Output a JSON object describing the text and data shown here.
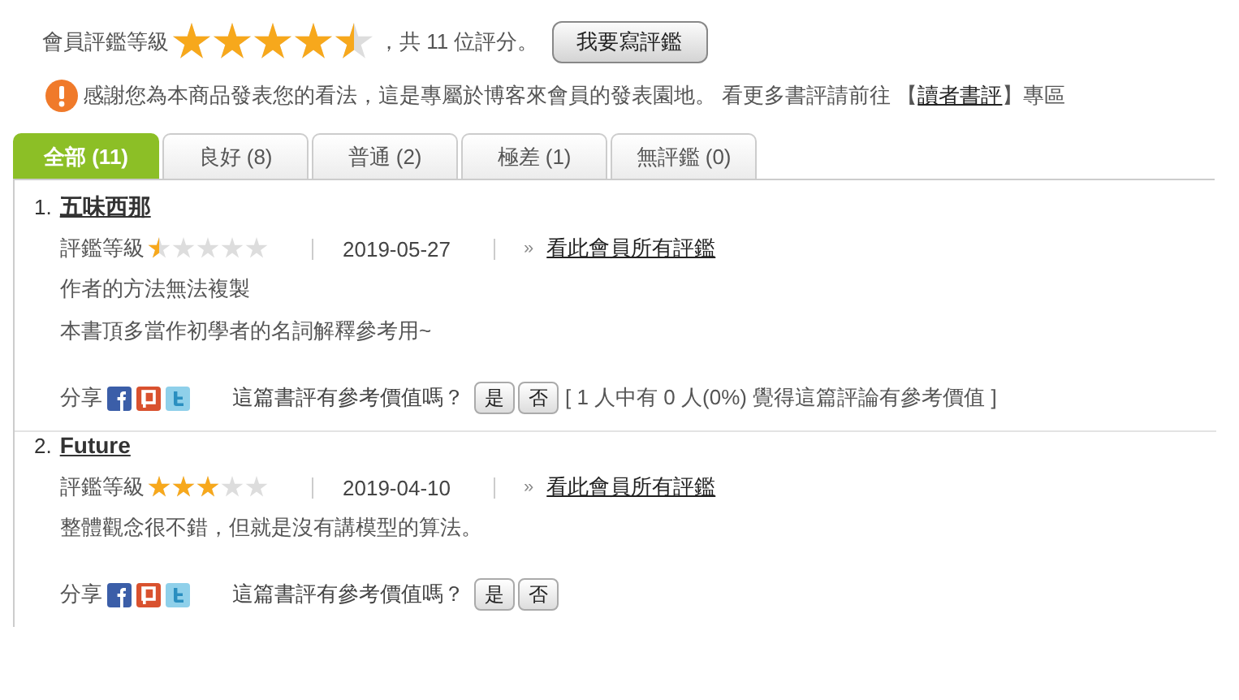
{
  "summary": {
    "label": "會員評鑑等級",
    "stars": 4.5,
    "count_text": "，共 11 位評分。",
    "write_button": "我要寫評鑑"
  },
  "notice": {
    "text": "感謝您為本商品發表您的看法，這是專屬於博客來會員的發表園地。 看更多書評請前往 【",
    "link": "讀者書評",
    "suffix": "】專區"
  },
  "tabs": [
    {
      "label": "全部 (11)",
      "selected": true
    },
    {
      "label": "良好 (8)",
      "selected": false
    },
    {
      "label": "普通 (2)",
      "selected": false
    },
    {
      "label": "極差 (1)",
      "selected": false
    },
    {
      "label": "無評鑑 (0)",
      "selected": false
    }
  ],
  "reviews": [
    {
      "number": "1.",
      "reviewer": "五味西那",
      "rating_label": "評鑑等級",
      "stars": 0.5,
      "date": "2019-05-27",
      "more_marker": "»",
      "more_link": "看此會員所有評鑑",
      "lines": [
        "作者的方法無法複製",
        "本書頂多當作初學者的名詞解釋參考用~"
      ],
      "share_label": "分享",
      "helpful_question": "這篇書評有參考價值嗎？",
      "yes": "是",
      "no": "否",
      "helpful_stats": "[ 1 人中有 0 人(0%) 覺得這篇評論有參考價值 ]"
    },
    {
      "number": "2.",
      "reviewer": "Future",
      "rating_label": "評鑑等級",
      "stars": 3,
      "date": "2019-04-10",
      "more_marker": "»",
      "more_link": "看此會員所有評鑑",
      "lines": [
        "整體觀念很不錯，但就是沒有講模型的算法。"
      ],
      "share_label": "分享",
      "helpful_question": "這篇書評有參考價值嗎？",
      "yes": "是",
      "no": "否"
    }
  ]
}
